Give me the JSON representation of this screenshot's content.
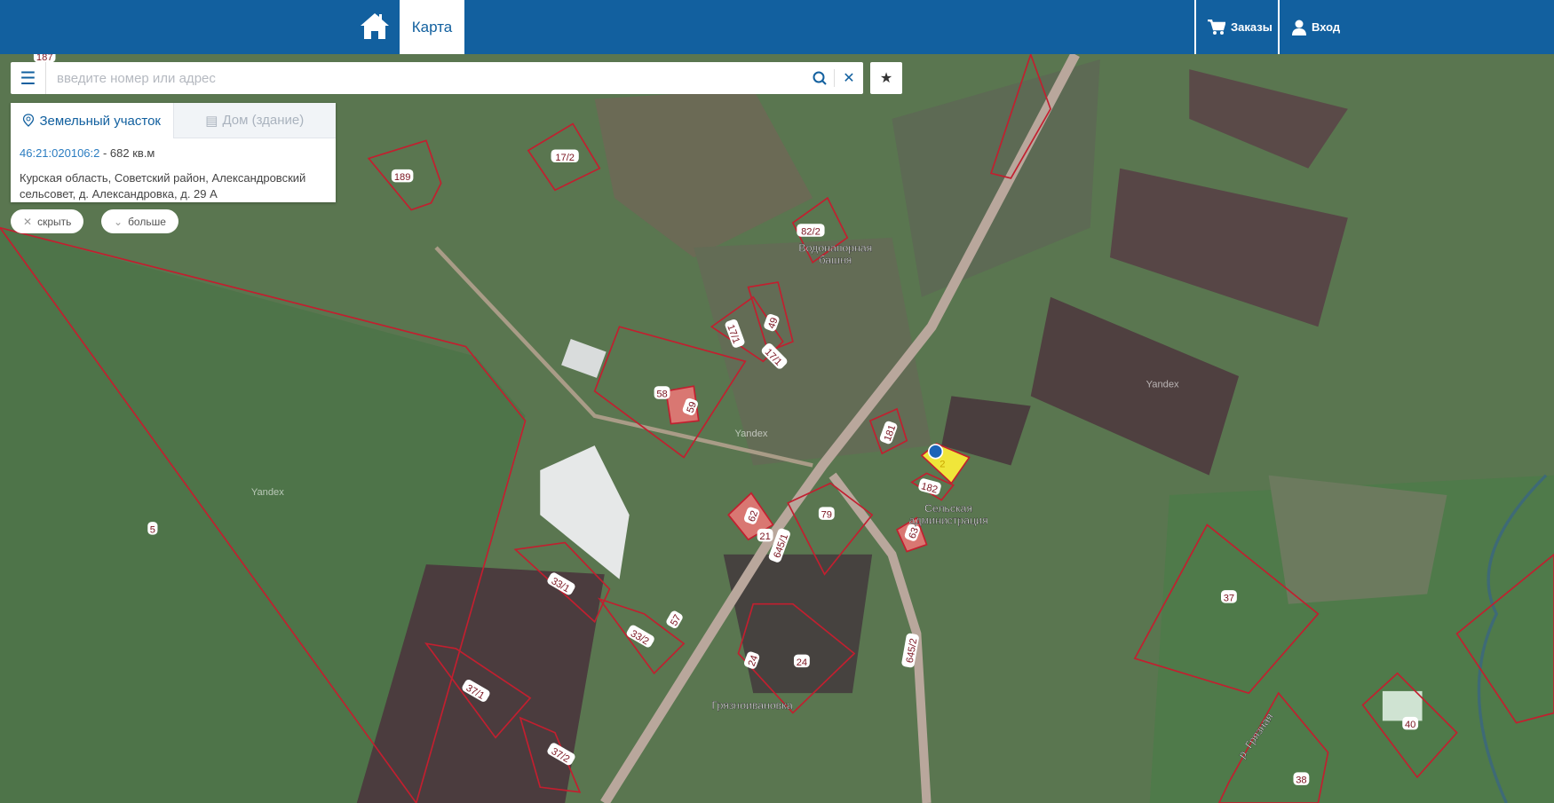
{
  "header": {
    "home_icon": "home-icon",
    "tab_map": "Карта",
    "orders": "Заказы",
    "login": "Вход",
    "color": "#12609f"
  },
  "search": {
    "placeholder": "введите номер или адрес",
    "value": ""
  },
  "panel": {
    "tab_land": "Земельный участок",
    "tab_house": "Дом (здание)",
    "cadastral_number": "46:21:020106:2",
    "area": " - 682 кв.м",
    "address": "Курская область, Советский район, Александровский сельсовет, д. Александровка, д. 29 А"
  },
  "buttons": {
    "hide": "скрыть",
    "more": "больше"
  },
  "map": {
    "parcel_labels": [
      "187",
      "17/2",
      "189",
      "82/2",
      "17/1",
      "49",
      "17/1",
      "58",
      "59",
      "181",
      "2",
      "182",
      "79",
      "62",
      "21",
      "645/1",
      "63",
      "33/1",
      "57",
      "33/2",
      "37/1",
      "24",
      "24",
      "645/2",
      "37/2",
      "37",
      "40",
      "38",
      "5"
    ],
    "place_labels": [
      "Водонапорная башня",
      "Сельская администрация",
      "Грязноивановка",
      "р. Грязная",
      "Yandex",
      "Yandex",
      "Yandex"
    ],
    "parcel_color": "#c21f2f",
    "selected_color": "#f0e63a"
  }
}
